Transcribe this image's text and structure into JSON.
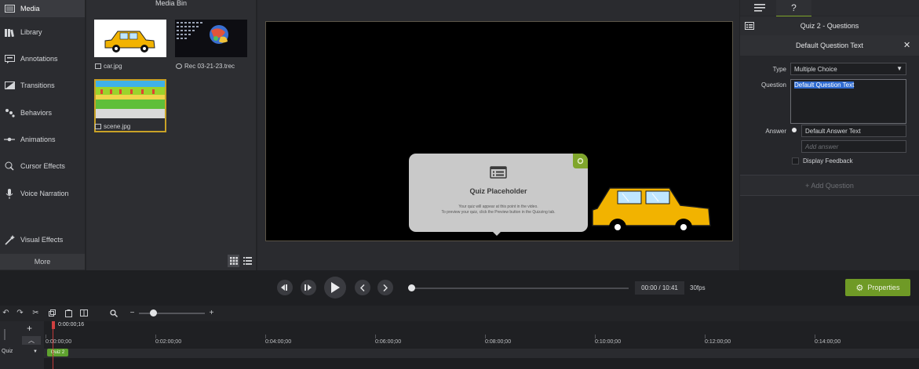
{
  "nav": {
    "items": [
      {
        "label": "Media",
        "icon": "media-icon",
        "active": true
      },
      {
        "label": "Library",
        "icon": "library-icon"
      },
      {
        "label": "Annotations",
        "icon": "annotations-icon"
      },
      {
        "label": "Transitions",
        "icon": "transitions-icon"
      },
      {
        "label": "Behaviors",
        "icon": "behaviors-icon"
      },
      {
        "label": "Animations",
        "icon": "animations-icon"
      },
      {
        "label": "Cursor Effects",
        "icon": "cursor-effects-icon"
      },
      {
        "label": "Voice Narration",
        "icon": "microphone-icon"
      },
      {
        "label": "Visual Effects",
        "icon": "visual-effects-icon"
      }
    ],
    "more_label": "More"
  },
  "mediabin": {
    "title": "Media Bin",
    "items": [
      {
        "label": "car.jpg",
        "icon": "image-icon"
      },
      {
        "label": "Rec 03-21-23.trec",
        "icon": "recording-icon"
      },
      {
        "label": "scene.jpg",
        "icon": "image-icon",
        "selected": true
      }
    ]
  },
  "canvas": {
    "quiz_title": "Quiz Placeholder",
    "quiz_desc_line1": "Your quiz will appear at this point in the video.",
    "quiz_desc_line2": "To preview your quiz, click the Preview button in the Quizzing tab."
  },
  "props": {
    "section_title": "Quiz 2 - Questions",
    "question_header": "Default Question Text",
    "type_label": "Type",
    "type_value": "Multiple Choice",
    "question_label": "Question",
    "question_value": "Default Question Text",
    "answer_label": "Answer",
    "answer_value": "Default Answer Text",
    "add_answer_placeholder": "Add answer",
    "display_feedback_label": "Display Feedback",
    "add_question_label": "+ Add Question"
  },
  "playback": {
    "timecode": "00:00 / 10:41",
    "fps": "30fps",
    "properties_label": "Properties"
  },
  "timeline": {
    "playhead_time": "0:00:00;16",
    "track_name": "Quiz",
    "marker_label": "Quiz 2",
    "ticks": [
      "0:00:00;00",
      "0:02:00;00",
      "0:04:00;00",
      "0:06:00;00",
      "0:08:00;00",
      "0:10:00;00",
      "0:12:00;00",
      "0:14:00;00"
    ]
  },
  "colors": {
    "accent": "#6f9a26",
    "taxi": "#f2b300",
    "playhead": "#d04040"
  }
}
